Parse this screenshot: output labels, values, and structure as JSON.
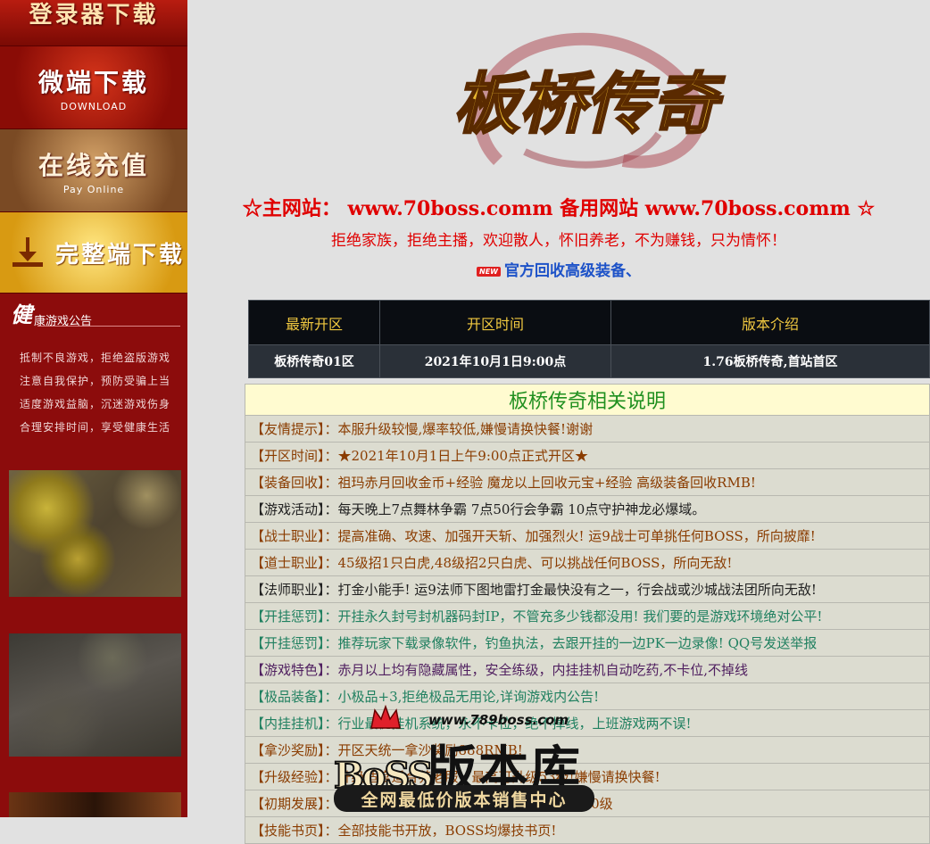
{
  "sidebar": {
    "login_label": "登录器下载",
    "micro_label": "微端下载",
    "micro_sub": "DOWNLOAD",
    "pay_label": "在线充值",
    "pay_sub": "Pay Online",
    "full_label": "完整端下载",
    "notice_first_char": "健",
    "notice_title": "康游戏公告",
    "notice_lines": [
      "抵制不良游戏，拒绝盗版游戏",
      "注意自我保护，预防受骗上当",
      "适度游戏益脑，沉迷游戏伤身",
      "合理安排时间，享受健康生活"
    ]
  },
  "logo_text": "板桥传奇",
  "site_line": "☆主网站： www.70boss.comm 备用网站 www.70boss.comm ☆",
  "motto": "拒绝家族，拒绝主播，欢迎散人，怀旧养老，不为赚钱，只为情怀！",
  "news_badge": "NEW",
  "news_text": "官方回收高级装备、",
  "server_table": {
    "headers": [
      "最新开区",
      "开区时间",
      "版本介绍"
    ],
    "row": [
      "板桥传奇01区",
      "2021年10月1日9:00点",
      "1.76板桥传奇,首站首区"
    ]
  },
  "info": {
    "caption": "板桥传奇相关说明",
    "items": [
      {
        "text": "【友情提示】：本服升级较慢,爆率较低,嫌慢请换快餐!谢谢",
        "color": "#8a3c00"
      },
      {
        "text": "【开区时间】：★2021年10月1日上午9:00点正式开区★",
        "color": "#8a3c00"
      },
      {
        "text": "【装备回收】：祖玛赤月回收金币+经验 魔龙以上回收元宝+经验 高级装备回收RMB!",
        "color": "#8a3c00"
      },
      {
        "text": "【游戏活动】：每天晚上7点舞林争霸 7点50行会争霸 10点守护神龙必爆域。",
        "color": "#202020"
      },
      {
        "text": "【战士职业】：提高准确、攻速、加强开天斩、加强烈火! 运9战士可单挑任何BOSS，所向披靡!",
        "color": "#8a3c00"
      },
      {
        "text": "【道士职业】：45级招1只白虎,48级招2只白虎、可以挑战任何BOSS，所向无敌!",
        "color": "#8a3c00"
      },
      {
        "text": "【法师职业】：打金小能手! 运9法师下图地雷打金最快没有之一，行会战或沙城战法团所向无敌!",
        "color": "#202020"
      },
      {
        "text": "【开挂惩罚】：开挂永久封号封机器码封IP，不管充多少钱都没用! 我们要的是游戏环境绝对公平!",
        "color": "#208060"
      },
      {
        "text": "【开挂惩罚】：推荐玩家下载录像软件，钓鱼执法，去跟开挂的一边PK一边录像! QQ号发送举报",
        "color": "#208060"
      },
      {
        "text": "【游戏特色】：赤月以上均有隐藏属性，安全练级，内挂挂机自动吃药,不卡位,不掉线",
        "color": "#502060"
      },
      {
        "text": "【极品装备】：小极品+3,拒绝极品无用论,详询游戏内公告!",
        "color": "#208060"
      },
      {
        "text": "【内挂挂机】：行业最优挂机系统，永不卡位，绝不掉线，上班游戏两不误!",
        "color": "#208060"
      },
      {
        "text": "【拿沙奖励】：开区天统一拿沙奖励888RMB!",
        "color": "#8a3c00"
      },
      {
        "text": "【升级经验】：升级适度适合养老服，最高可升级53级!嫌慢请换快餐!",
        "color": "#8a3c00"
      },
      {
        "text": "【初期发展】：新区初期打猪打怪，五猪7级3分钟可以到30级",
        "color": "#8a3c00"
      },
      {
        "text": "【技能书页】：全部技能书开放，BOSS均爆技书页!",
        "color": "#8a3c00"
      }
    ]
  },
  "watermark": {
    "site": "www.789boss.com",
    "boss": "BoSS",
    "big": "版本库",
    "slogan": "全网最低价版本销售中心"
  },
  "colors": {
    "sidebar_bg": "#8c0c0c",
    "accent_red": "#e00000",
    "link_blue": "#1d52c8",
    "table_head_text": "#f0c840",
    "caption_green": "#209020"
  }
}
